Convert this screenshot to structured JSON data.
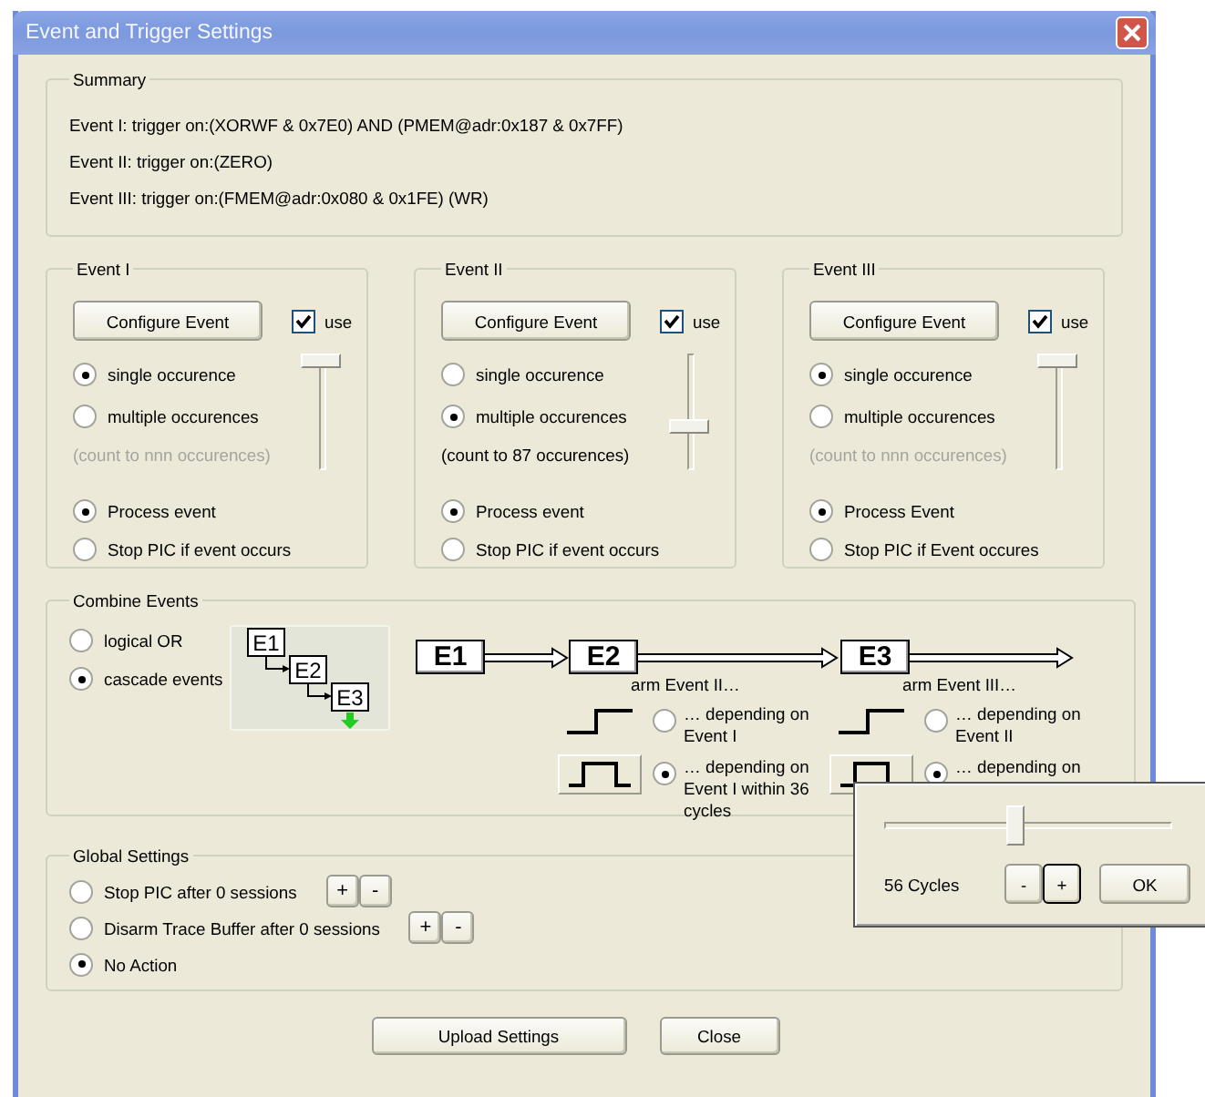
{
  "window": {
    "title": "Event and Trigger Settings"
  },
  "summary": {
    "title": "Summary",
    "lines": [
      "Event I: trigger on:(XORWF & 0x7E0) AND (PMEM@adr:0x187 & 0x7FF)",
      "Event II: trigger on:(ZERO)",
      "Event III: trigger on:(FMEM@adr:0x080 & 0x1FE) (WR)"
    ]
  },
  "events": [
    {
      "title": "Event I",
      "configure": "Configure Event",
      "use": {
        "label": "use",
        "checked": true
      },
      "occurrences": [
        {
          "label": "single occurence",
          "selected": true
        },
        {
          "label": "multiple occurences",
          "selected": false
        }
      ],
      "count": {
        "text": "(count to nnn occurences)",
        "disabled": true
      },
      "level": 1,
      "actions": [
        {
          "label": "Process event",
          "selected": true
        },
        {
          "label": "Stop PIC if event occurs",
          "selected": false
        }
      ]
    },
    {
      "title": "Event II",
      "configure": "Configure Event",
      "use": {
        "label": "use",
        "checked": true
      },
      "occurrences": [
        {
          "label": "single occurence",
          "selected": false
        },
        {
          "label": "multiple occurences",
          "selected": true
        }
      ],
      "count": {
        "text": "(count to 87 occurences)",
        "disabled": false
      },
      "level": 0.35,
      "actions": [
        {
          "label": "Process event",
          "selected": true
        },
        {
          "label": "Stop PIC if event occurs",
          "selected": false
        }
      ]
    },
    {
      "title": "Event III",
      "configure": "Configure Event",
      "use": {
        "label": "use",
        "checked": true
      },
      "occurrences": [
        {
          "label": "single occurence",
          "selected": true
        },
        {
          "label": "multiple occurences",
          "selected": false
        }
      ],
      "count": {
        "text": "(count to nnn occurences)",
        "disabled": true
      },
      "level": 1,
      "actions": [
        {
          "label": "Process Event",
          "selected": true
        },
        {
          "label": "Stop PIC if Event occures",
          "selected": false
        }
      ]
    }
  ],
  "combine": {
    "title": "Combine Events",
    "modes": [
      {
        "label": "logical OR",
        "selected": false
      },
      {
        "label": "cascade events",
        "selected": true
      }
    ],
    "diagram": [
      "E1",
      "E2",
      "E3"
    ],
    "chain": [
      {
        "label": "E1"
      },
      {
        "label": "E2",
        "arm": "arm Event II…",
        "options": [
          {
            "kind": "edge",
            "label": "… depending on Event I",
            "selected": false
          },
          {
            "kind": "pulse",
            "label": "… depending on Event I within 36 cycles",
            "selected": true
          }
        ]
      },
      {
        "label": "E3",
        "arm": "arm Event III…",
        "options": [
          {
            "kind": "edge",
            "label": "… depending on Event II",
            "selected": false
          },
          {
            "kind": "pulse",
            "label": "… depending on",
            "selected": true
          }
        ]
      }
    ]
  },
  "global": {
    "title": "Global Settings",
    "options": [
      {
        "label": "Stop PIC after 0 sessions",
        "selected": false,
        "steppers": [
          "+",
          "-"
        ]
      },
      {
        "label": "Disarm Trace Buffer after 0 sessions",
        "selected": false,
        "steppers": [
          "+",
          "-"
        ]
      },
      {
        "label": "No Action",
        "selected": true
      }
    ]
  },
  "buttons": [
    "Upload Settings",
    "Close"
  ],
  "popup": {
    "level": 0.45,
    "reading": "56 Cycles",
    "buttons": [
      {
        "label": "-",
        "focused": false
      },
      {
        "label": "+",
        "focused": true
      },
      {
        "label": "OK",
        "focused": false
      }
    ]
  }
}
